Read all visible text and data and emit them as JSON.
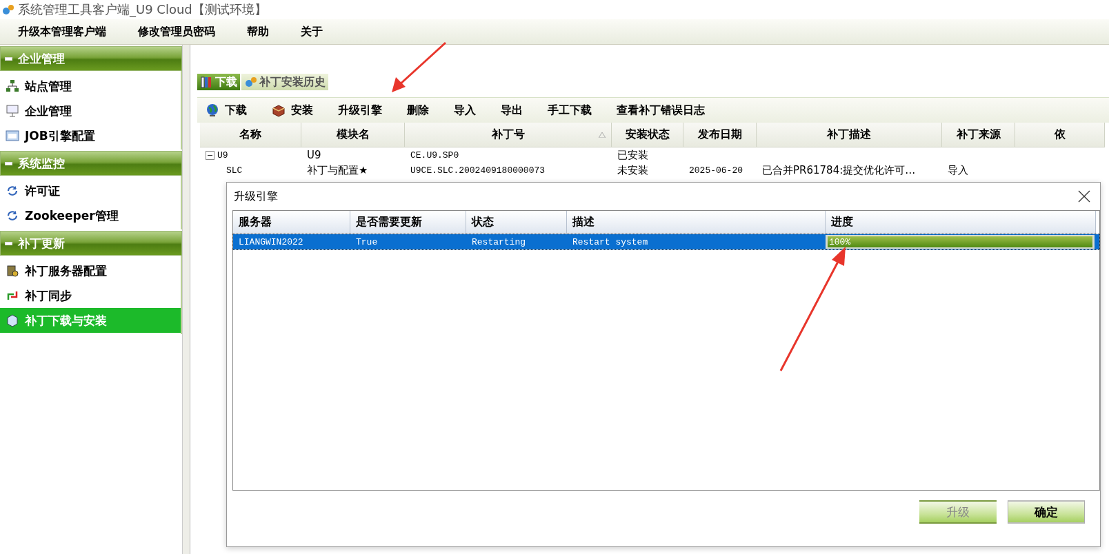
{
  "window": {
    "title": "系统管理工具客户端_U9 Cloud【测试环境】"
  },
  "menu": [
    "升级本管理客户端",
    "修改管理员密码",
    "帮助",
    "关于"
  ],
  "sidebar": {
    "groups": [
      {
        "title": "企业管理",
        "expanded": true,
        "items": [
          {
            "label": "站点管理",
            "selected": false
          },
          {
            "label": "企业管理",
            "selected": false
          },
          {
            "label": "JOB引擎配置",
            "selected": false
          }
        ]
      },
      {
        "title": "系统监控",
        "expanded": true,
        "items": [
          {
            "label": "许可证",
            "selected": false
          },
          {
            "label": "Zookeeper管理",
            "selected": false
          }
        ]
      },
      {
        "title": "补丁更新",
        "expanded": true,
        "items": [
          {
            "label": "补丁服务器配置",
            "selected": false
          },
          {
            "label": "补丁同步",
            "selected": false
          },
          {
            "label": "补丁下载与安装",
            "selected": true
          }
        ]
      }
    ]
  },
  "tabs": [
    {
      "label": "下载",
      "selected": true
    },
    {
      "label": "补丁安装历史",
      "selected": false
    }
  ],
  "toolbar": [
    "下载",
    "安装",
    "升级引擎",
    "删除",
    "导入",
    "导出",
    "手工下载",
    "查看补丁错误日志"
  ],
  "table": {
    "columns": [
      {
        "label": "名称",
        "sorted": false
      },
      {
        "label": "模块名",
        "sorted": false
      },
      {
        "label": "补丁号",
        "sorted": true
      },
      {
        "label": "安装状态",
        "sorted": false
      },
      {
        "label": "发布日期",
        "sorted": false
      },
      {
        "label": "补丁描述",
        "sorted": false
      },
      {
        "label": "补丁来源",
        "sorted": false
      },
      {
        "label": "依",
        "sorted": false
      }
    ],
    "rows": [
      {
        "name": "U9",
        "module": "U9",
        "patch_no": "CE.U9.SP0",
        "status": "已安装",
        "expanded": true,
        "children": [
          {
            "name": "SLC",
            "module": "补丁与配置★",
            "patch_no": "U9CE.SLC.2002409180000073",
            "status": "未安装",
            "date": "2025-06-20",
            "description": "已合并PR61784:提交优化许可…",
            "source": "导入"
          }
        ]
      }
    ]
  },
  "dialog": {
    "title": "升级引擎",
    "columns": [
      "服务器",
      "是否需要更新",
      "状态",
      "描述",
      "进度"
    ],
    "rows": [
      {
        "server": "LIANGWIN2022",
        "needs_update": "True",
        "status": "Restarting",
        "description": "Restart system",
        "progress": "100%",
        "level": 1,
        "selected": true
      }
    ],
    "buttons": [
      {
        "label": "升级",
        "disabled": true
      },
      {
        "label": "确定",
        "disabled": false
      }
    ]
  }
}
